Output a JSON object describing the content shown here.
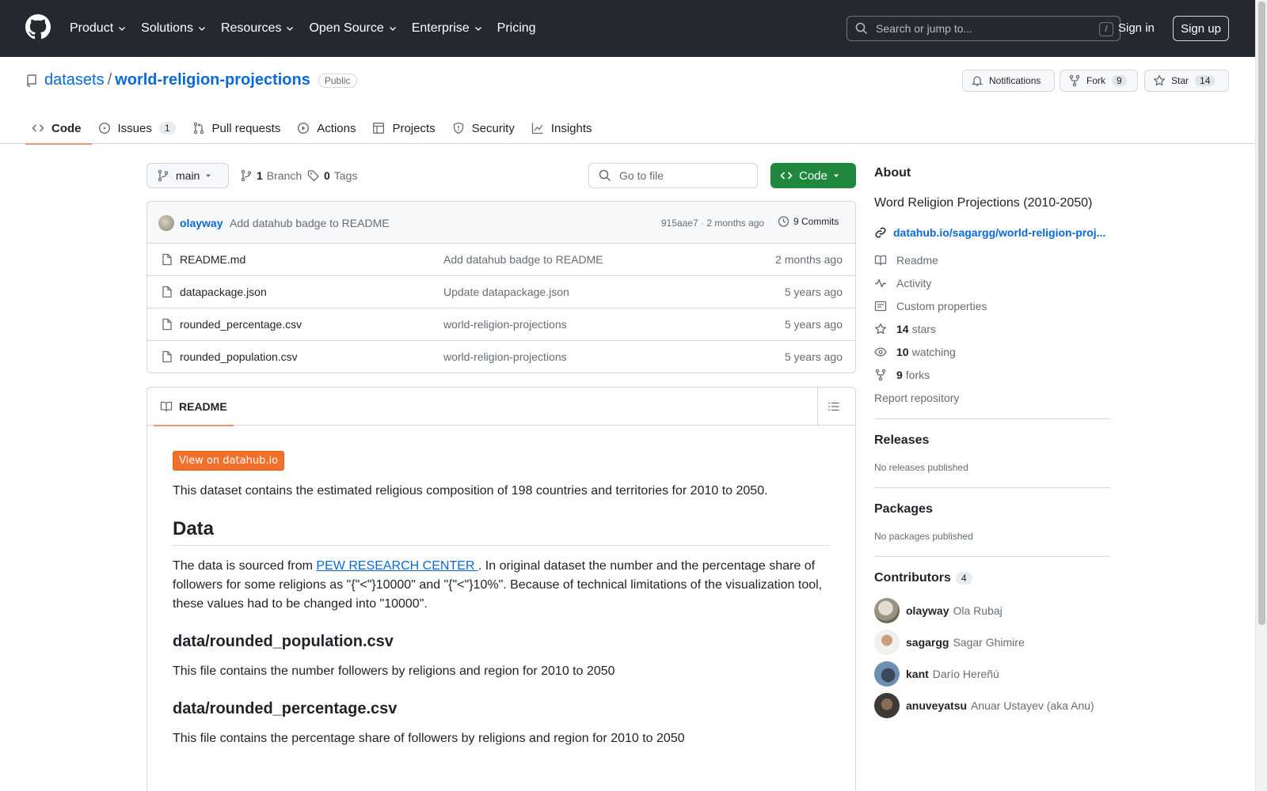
{
  "header": {
    "nav": [
      "Product",
      "Solutions",
      "Resources",
      "Open Source",
      "Enterprise",
      "Pricing"
    ],
    "search_placeholder": "Search or jump to...",
    "search_shortcut": "/",
    "signin": "Sign in",
    "signup": "Sign up"
  },
  "repo": {
    "owner": "datasets",
    "separator": "/",
    "name": "world-religion-projections",
    "visibility": "Public",
    "notifications_label": "Notifications",
    "fork_label": "Fork",
    "fork_count": "9",
    "star_label": "Star",
    "star_count": "14"
  },
  "tabs": [
    {
      "label": "Code",
      "icon": "code-icon"
    },
    {
      "label": "Issues",
      "count": "1",
      "icon": "issue-icon"
    },
    {
      "label": "Pull requests",
      "icon": "pull-request-icon"
    },
    {
      "label": "Actions",
      "icon": "play-icon"
    },
    {
      "label": "Projects",
      "icon": "table-icon"
    },
    {
      "label": "Security",
      "icon": "shield-icon"
    },
    {
      "label": "Insights",
      "icon": "graph-icon"
    }
  ],
  "toolbar": {
    "branch": "main",
    "branch_count": "1",
    "branch_label": "Branch",
    "tag_count": "0",
    "tag_label": "Tags",
    "go_to_file": "Go to file",
    "code_button": "Code"
  },
  "latest_commit": {
    "author": "olayway",
    "message": "Add datahub badge to README",
    "sha_time": "915aae7 · 2 months ago",
    "commits": "9 Commits"
  },
  "files": [
    {
      "name": "README.md",
      "message": "Add datahub badge to README",
      "date": "2 months ago"
    },
    {
      "name": "datapackage.json",
      "message": "Update datapackage.json",
      "date": "5 years ago"
    },
    {
      "name": "rounded_percentage.csv",
      "message": "world-religion-projections",
      "date": "5 years ago"
    },
    {
      "name": "rounded_population.csv",
      "message": "world-religion-projections",
      "date": "5 years ago"
    }
  ],
  "readme": {
    "tab_label": "README",
    "badge": "View on datahub.io",
    "intro": "This dataset contains the estimated religious composition of 198 countries and territories for 2010 to 2050.",
    "h_data": "Data",
    "data_p_before": "The data is sourced from ",
    "data_p_link": "PEW RESEARCH CENTER ",
    "data_p_after": ". In original dataset the number and the percentage share of followers for some religions as \"{\"<\"}10000\" and \"{\"<\"}10%\". Because of technical limitations of the visualization tool, these values had to be changed into \"10000\".",
    "h_pop": "data/rounded_population.csv",
    "pop_p": "This file contains the number followers by religions and region for 2010 to 2050",
    "h_pct": "data/rounded_percentage.csv",
    "pct_p": "This file contains the percentage share of followers by religions and region for 2010 to 2050"
  },
  "about": {
    "title": "About",
    "description": "Word Religion Projections (2010-2050)",
    "homepage": "datahub.io/sagargg/world-religion-proj...",
    "readme": "Readme",
    "activity": "Activity",
    "custom_properties": "Custom properties",
    "stars_count": "14",
    "stars_label": "stars",
    "watching_count": "10",
    "watching_label": "watching",
    "forks_count": "9",
    "forks_label": "forks",
    "report": "Report repository"
  },
  "releases": {
    "title": "Releases",
    "empty": "No releases published"
  },
  "packages": {
    "title": "Packages",
    "empty": "No packages published"
  },
  "contributors": {
    "title": "Contributors",
    "count": "4",
    "list": [
      {
        "login": "olayway",
        "name": "Ola Rubaj"
      },
      {
        "login": "sagargg",
        "name": "Sagar Ghimire"
      },
      {
        "login": "kant",
        "name": "Darío Hereñú"
      },
      {
        "login": "anuveyatsu",
        "name": "Anuar Ustayev (aka Anu)"
      }
    ]
  },
  "colors": {
    "accent": "#0969da",
    "header_bg": "#24292f",
    "code_button": "#1f883d",
    "tab_underline": "#fd8c73",
    "datahub_badge": "#f3702a"
  }
}
